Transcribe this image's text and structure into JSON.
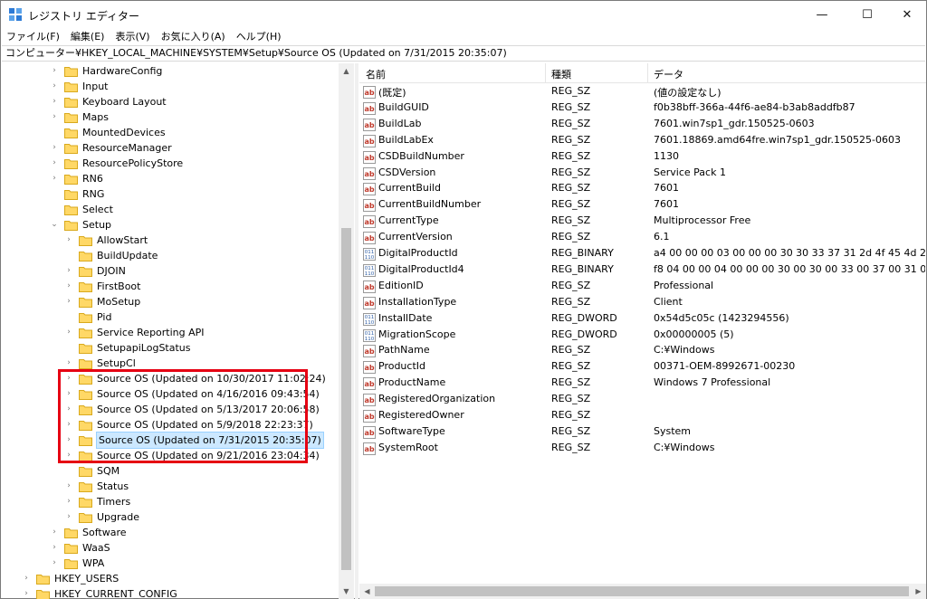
{
  "window": {
    "title": "レジストリ エディター",
    "minimize_glyph": "—",
    "maximize_glyph": "☐",
    "close_glyph": "✕"
  },
  "menu": [
    "ファイル(F)",
    "編集(E)",
    "表示(V)",
    "お気に入り(A)",
    "ヘルプ(H)"
  ],
  "address": "コンピューター¥HKEY_LOCAL_MACHINE¥SYSTEM¥Setup¥Source OS (Updated on 7/31/2015 20:35:07)",
  "tree": [
    {
      "label": "HardwareConfig",
      "level": 2,
      "chevron": "›",
      "selected": false
    },
    {
      "label": "Input",
      "level": 2,
      "chevron": "›",
      "selected": false
    },
    {
      "label": "Keyboard Layout",
      "level": 2,
      "chevron": "›",
      "selected": false
    },
    {
      "label": "Maps",
      "level": 2,
      "chevron": "›",
      "selected": false
    },
    {
      "label": "MountedDevices",
      "level": 2,
      "chevron": "",
      "selected": false
    },
    {
      "label": "ResourceManager",
      "level": 2,
      "chevron": "›",
      "selected": false
    },
    {
      "label": "ResourcePolicyStore",
      "level": 2,
      "chevron": "›",
      "selected": false
    },
    {
      "label": "RN6",
      "level": 2,
      "chevron": "›",
      "selected": false
    },
    {
      "label": "RNG",
      "level": 2,
      "chevron": "",
      "selected": false
    },
    {
      "label": "Select",
      "level": 2,
      "chevron": "",
      "selected": false
    },
    {
      "label": "Setup",
      "level": 2,
      "chevron": "⌄",
      "selected": false
    },
    {
      "label": "AllowStart",
      "level": 3,
      "chevron": "›",
      "selected": false
    },
    {
      "label": "BuildUpdate",
      "level": 3,
      "chevron": "",
      "selected": false
    },
    {
      "label": "DJOIN",
      "level": 3,
      "chevron": "›",
      "selected": false
    },
    {
      "label": "FirstBoot",
      "level": 3,
      "chevron": "›",
      "selected": false
    },
    {
      "label": "MoSetup",
      "level": 3,
      "chevron": "›",
      "selected": false
    },
    {
      "label": "Pid",
      "level": 3,
      "chevron": "",
      "selected": false
    },
    {
      "label": "Service Reporting API",
      "level": 3,
      "chevron": "›",
      "selected": false
    },
    {
      "label": "SetupapiLogStatus",
      "level": 3,
      "chevron": "",
      "selected": false
    },
    {
      "label": "SetupCl",
      "level": 3,
      "chevron": "›",
      "selected": false
    },
    {
      "label": "Source OS (Updated on 10/30/2017 11:02:24)",
      "level": 3,
      "chevron": "›",
      "selected": false
    },
    {
      "label": "Source OS (Updated on 4/16/2016 09:43:54)",
      "level": 3,
      "chevron": "›",
      "selected": false
    },
    {
      "label": "Source OS (Updated on 5/13/2017 20:06:58)",
      "level": 3,
      "chevron": "›",
      "selected": false
    },
    {
      "label": "Source OS (Updated on 5/9/2018 22:23:37)",
      "level": 3,
      "chevron": "›",
      "selected": false
    },
    {
      "label": "Source OS (Updated on 7/31/2015 20:35:07)",
      "level": 3,
      "chevron": "›",
      "selected": true
    },
    {
      "label": "Source OS (Updated on 9/21/2016 23:04:34)",
      "level": 3,
      "chevron": "›",
      "selected": false
    },
    {
      "label": "SQM",
      "level": 3,
      "chevron": "",
      "selected": false
    },
    {
      "label": "Status",
      "level": 3,
      "chevron": "›",
      "selected": false
    },
    {
      "label": "Timers",
      "level": 3,
      "chevron": "›",
      "selected": false
    },
    {
      "label": "Upgrade",
      "level": 3,
      "chevron": "›",
      "selected": false
    },
    {
      "label": "Software",
      "level": 2,
      "chevron": "›",
      "selected": false
    },
    {
      "label": "WaaS",
      "level": 2,
      "chevron": "›",
      "selected": false
    },
    {
      "label": "WPA",
      "level": 2,
      "chevron": "›",
      "selected": false
    },
    {
      "label": "HKEY_USERS",
      "level": 0,
      "chevron": "›",
      "selected": false
    },
    {
      "label": "HKEY_CURRENT_CONFIG",
      "level": 0,
      "chevron": "›",
      "selected": false
    }
  ],
  "list": {
    "headers": {
      "name": "名前",
      "type": "種類",
      "data": "データ"
    },
    "rows": [
      {
        "name": "(既定)",
        "type": "REG_SZ",
        "data": "(値の設定なし)",
        "icon": "string"
      },
      {
        "name": "BuildGUID",
        "type": "REG_SZ",
        "data": "f0b38bff-366a-44f6-ae84-b3ab8addfb87",
        "icon": "string"
      },
      {
        "name": "BuildLab",
        "type": "REG_SZ",
        "data": "7601.win7sp1_gdr.150525-0603",
        "icon": "string"
      },
      {
        "name": "BuildLabEx",
        "type": "REG_SZ",
        "data": "7601.18869.amd64fre.win7sp1_gdr.150525-0603",
        "icon": "string"
      },
      {
        "name": "CSDBuildNumber",
        "type": "REG_SZ",
        "data": "1130",
        "icon": "string"
      },
      {
        "name": "CSDVersion",
        "type": "REG_SZ",
        "data": "Service Pack 1",
        "icon": "string"
      },
      {
        "name": "CurrentBuild",
        "type": "REG_SZ",
        "data": "7601",
        "icon": "string"
      },
      {
        "name": "CurrentBuildNumber",
        "type": "REG_SZ",
        "data": "7601",
        "icon": "string"
      },
      {
        "name": "CurrentType",
        "type": "REG_SZ",
        "data": "Multiprocessor Free",
        "icon": "string"
      },
      {
        "name": "CurrentVersion",
        "type": "REG_SZ",
        "data": "6.1",
        "icon": "string"
      },
      {
        "name": "DigitalProductId",
        "type": "REG_BINARY",
        "data": "a4 00 00 00 03 00 00 00 30 30 33 37 31 2d 4f 45 4d 2d 38 39 39 32",
        "icon": "binary"
      },
      {
        "name": "DigitalProductId4",
        "type": "REG_BINARY",
        "data": "f8 04 00 00 04 00 00 00 30 00 30 00 33 00 37 00 31 00 2d 00 30 00 4f",
        "icon": "binary"
      },
      {
        "name": "EditionID",
        "type": "REG_SZ",
        "data": "Professional",
        "icon": "string"
      },
      {
        "name": "InstallationType",
        "type": "REG_SZ",
        "data": "Client",
        "icon": "string"
      },
      {
        "name": "InstallDate",
        "type": "REG_DWORD",
        "data": "0x54d5c05c (1423294556)",
        "icon": "binary"
      },
      {
        "name": "MigrationScope",
        "type": "REG_DWORD",
        "data": "0x00000005 (5)",
        "icon": "binary"
      },
      {
        "name": "PathName",
        "type": "REG_SZ",
        "data": "C:¥Windows",
        "icon": "string"
      },
      {
        "name": "ProductId",
        "type": "REG_SZ",
        "data": "00371-OEM-8992671-00230",
        "icon": "string"
      },
      {
        "name": "ProductName",
        "type": "REG_SZ",
        "data": "Windows 7 Professional",
        "icon": "string"
      },
      {
        "name": "RegisteredOrganization",
        "type": "REG_SZ",
        "data": "",
        "icon": "string"
      },
      {
        "name": "RegisteredOwner",
        "type": "REG_SZ",
        "data": "",
        "icon": "string"
      },
      {
        "name": "SoftwareType",
        "type": "REG_SZ",
        "data": "System",
        "icon": "string"
      },
      {
        "name": "SystemRoot",
        "type": "REG_SZ",
        "data": "C:¥Windows",
        "icon": "string"
      }
    ]
  },
  "colors": {
    "highlight_box": "#e60012",
    "selection_bg": "#cce8ff",
    "folder_fill": "#ffd866",
    "folder_stroke": "#d9a91c",
    "string_icon": "#c0392b",
    "binary_icon": "#2f5fa7"
  },
  "icons": {
    "app": "registry-editor-icon",
    "folder": "folder-icon",
    "string_value": "string-value-icon",
    "binary_value": "binary-value-icon"
  }
}
